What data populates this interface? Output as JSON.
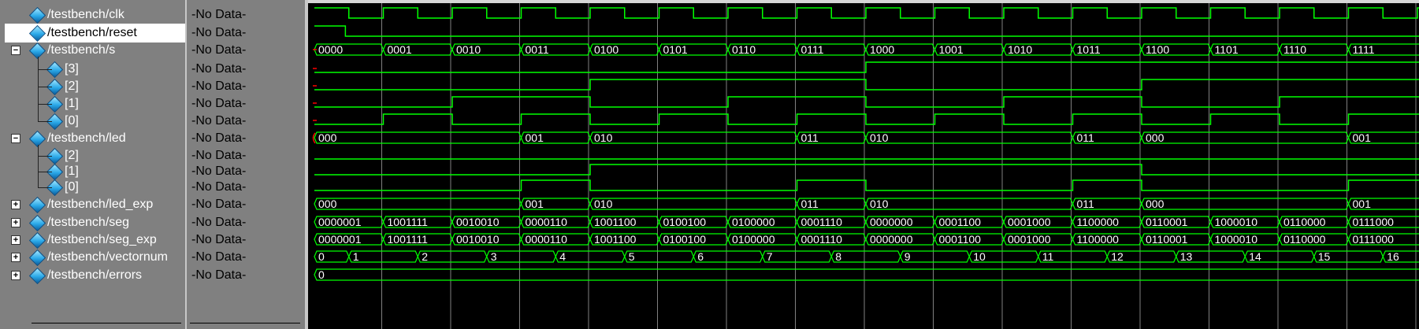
{
  "signals": [
    {
      "name": "/testbench/clk",
      "value": "-No Data-",
      "indent": 0,
      "expander": "",
      "selected": false
    },
    {
      "name": "/testbench/reset",
      "value": "-No Data-",
      "indent": 0,
      "expander": "",
      "selected": true
    },
    {
      "name": "/testbench/s",
      "value": "-No Data-",
      "indent": 0,
      "expander": "−",
      "selected": false
    },
    {
      "name": "[3]",
      "value": "-No Data-",
      "indent": 1,
      "expander": "",
      "selected": false
    },
    {
      "name": "[2]",
      "value": "-No Data-",
      "indent": 1,
      "expander": "",
      "selected": false
    },
    {
      "name": "[1]",
      "value": "-No Data-",
      "indent": 1,
      "expander": "",
      "selected": false
    },
    {
      "name": "[0]",
      "value": "-No Data-",
      "indent": 1,
      "expander": "",
      "selected": false
    },
    {
      "name": "/testbench/led",
      "value": "-No Data-",
      "indent": 0,
      "expander": "−",
      "selected": false
    },
    {
      "name": "[2]",
      "value": "-No Data-",
      "indent": 1,
      "expander": "",
      "selected": false
    },
    {
      "name": "[1]",
      "value": "-No Data-",
      "indent": 1,
      "expander": "",
      "selected": false
    },
    {
      "name": "[0]",
      "value": "-No Data-",
      "indent": 1,
      "expander": "",
      "selected": false
    },
    {
      "name": "/testbench/led_exp",
      "value": "-No Data-",
      "indent": 0,
      "expander": "+",
      "selected": false
    },
    {
      "name": "/testbench/seg",
      "value": "-No Data-",
      "indent": 0,
      "expander": "+",
      "selected": false
    },
    {
      "name": "/testbench/seg_exp",
      "value": "-No Data-",
      "indent": 0,
      "expander": "+",
      "selected": false
    },
    {
      "name": "/testbench/vectornum",
      "value": "-No Data-",
      "indent": 0,
      "expander": "+",
      "selected": false
    },
    {
      "name": "/testbench/errors",
      "value": "-No Data-",
      "indent": 0,
      "expander": "+",
      "selected": false
    }
  ],
  "waves": {
    "colors": {
      "signal": "#00ff00",
      "grid": "#808080",
      "background": "#000000",
      "marker": "#ff0000"
    },
    "s_bus": [
      "0000",
      "0001",
      "0010",
      "0011",
      "0100",
      "0101",
      "0110",
      "0111",
      "1000",
      "1001",
      "1010",
      "1011",
      "1100",
      "1101",
      "1110",
      "1111"
    ],
    "led_bus": [
      {
        "period": 0,
        "label": "000"
      },
      {
        "period": 3,
        "label": "001"
      },
      {
        "period": 4,
        "label": "010"
      },
      {
        "period": 7,
        "label": "011"
      },
      {
        "period": 8,
        "label": "010"
      },
      {
        "period": 11,
        "label": "011"
      },
      {
        "period": 12,
        "label": "000"
      },
      {
        "period": 15,
        "label": "001"
      }
    ],
    "seg_bus": [
      "0000001",
      "1001111",
      "0010010",
      "0000110",
      "1001100",
      "0100100",
      "0100000",
      "0001110",
      "0000000",
      "0001100",
      "0001000",
      "1100000",
      "0110001",
      "1000010",
      "0110000",
      "0111000"
    ],
    "vectornum": [
      "0",
      "1",
      "2",
      "3",
      "4",
      "5",
      "6",
      "7",
      "8",
      "9",
      "10",
      "11",
      "12",
      "13",
      "14",
      "15",
      "16"
    ],
    "errors": "0"
  }
}
